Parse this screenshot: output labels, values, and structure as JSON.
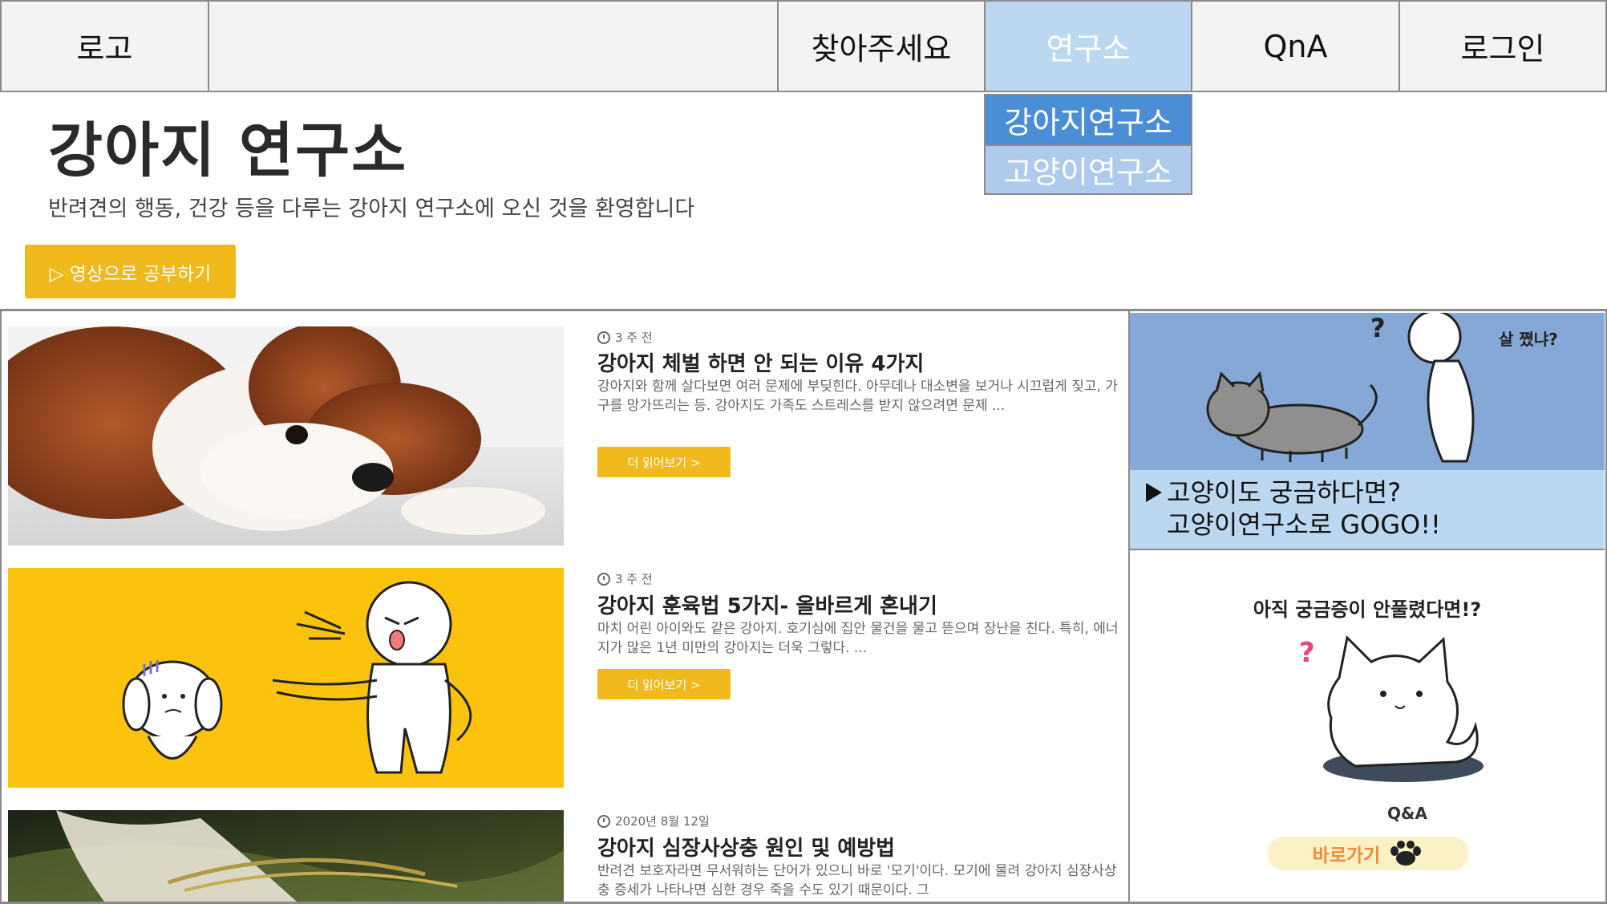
{
  "nav": {
    "logo": "로고",
    "items": [
      "찾아주세요",
      "연구소",
      "QnA",
      "로그인"
    ],
    "dropdown": [
      "강아지연구소",
      "고양이연구소"
    ]
  },
  "hero": {
    "title": "강아지 연구소",
    "subtitle": "반려견의 행동, 건강 등을 다루는 강아지 연구소에 오신 것을 환영합니다",
    "button": "▷ 영상으로 공부하기"
  },
  "articles": [
    {
      "date": "3 주 전",
      "title": "강아지 체벌 하면 안 되는 이유 4가지",
      "excerpt": "강아지와 함께 살다보면 여러 문제에 부딪힌다. 아무데나 대소변을 보거나 시끄럽게 짖고, 가구를 망가뜨리는 등. 강아지도 가족도 스트레스를 받지 않으려면 문제 ...",
      "button": "더 읽어보기 >"
    },
    {
      "date": "3 주 전",
      "title": "강아지 훈육법 5가지- 올바르게 혼내기",
      "excerpt": "마치 어린 아이와도 같은 강아지. 호기심에 집안 물건을 물고 뜯으며 장난을 친다. 특히, 에너지가 많은 1년 미만의 강아지는 더욱 그렇다. ...",
      "button": "더 읽어보기 >"
    },
    {
      "date": "2020년 8월 12일",
      "title": "강아지 심장사상충 원인 및 예방법",
      "excerpt": "반려견 보호자라면 무서워하는 단어가 있으니 바로 '모기'이다. 모기에 물려 강아지 심장사상충 증세가 나타나면 심한 경우 죽을 수도 있기 때문이다. 그",
      "button": ""
    }
  ],
  "sidebar": {
    "cat_banner_caption": "살 쪘냐?",
    "cat_line1": "고양이도 궁금하다면?",
    "cat_line2": "고양이연구소로 GOGO!!",
    "qa_title": "아직 궁금증이 안풀렸다면!?",
    "qa_label": "Q&A",
    "qa_button": "바로가기"
  },
  "colors": {
    "accent": "#f0b91c",
    "nav_active": "#bcd8f0",
    "dropdown_active": "#4a8fd6",
    "cat_banner": "#85a8d6"
  }
}
